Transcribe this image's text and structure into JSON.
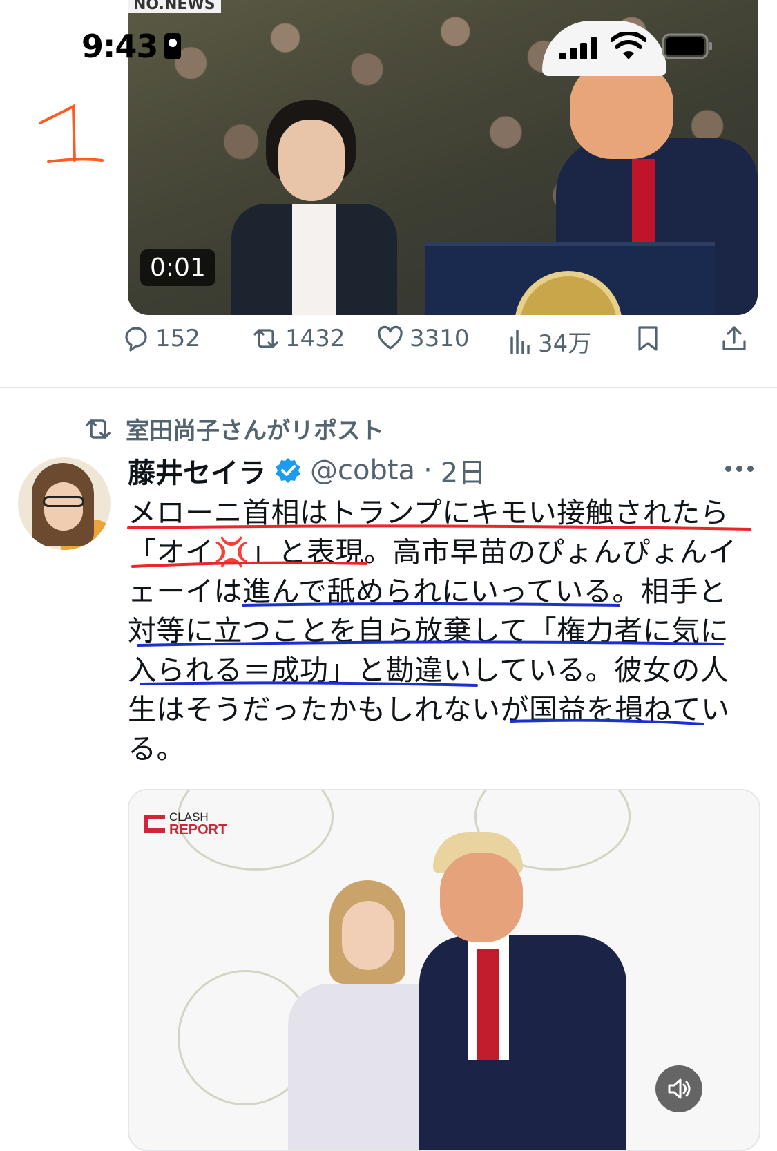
{
  "status_bar": {
    "time": "9:43",
    "icons": [
      "portrait-lock-icon",
      "cellular-signal-icon",
      "wifi-icon",
      "battery-icon"
    ]
  },
  "annotation": {
    "number_label": "1",
    "color": "#ff5a1f"
  },
  "media_top": {
    "watermark": "NO.NEWS",
    "timestamp": "0:01"
  },
  "actions": {
    "reply_count": "152",
    "repost_count": "1432",
    "like_count": "3310",
    "views_count": "34万"
  },
  "tweet": {
    "reposted_by": "室田尚子さんがリポスト",
    "author_name": "藤井セイラ",
    "handle": "@cobta",
    "separator": "·",
    "time": "2日",
    "text_lines": [
      "メローニ首相はトランプにキモい接触されたら",
      "「オイ💢」と表現。高市早苗のぴょんぴょんイ",
      "ェーイは進んで舐められにいっている。相手と",
      "対等に立つことを自ら放棄して「権力者に気に",
      "入られる＝成功」と勘違いしている。彼女の人",
      "生はそうだったかもしれないが国益を損ねてい",
      "る。"
    ]
  },
  "media_bottom": {
    "brand_line1": "CLASH",
    "brand_line2": "REPORT"
  },
  "colors": {
    "text_primary": "#0f1419",
    "text_secondary": "#536471",
    "verified": "#1d9bf0",
    "underline_red": "#e8262b",
    "underline_blue": "#1d2fd0"
  }
}
